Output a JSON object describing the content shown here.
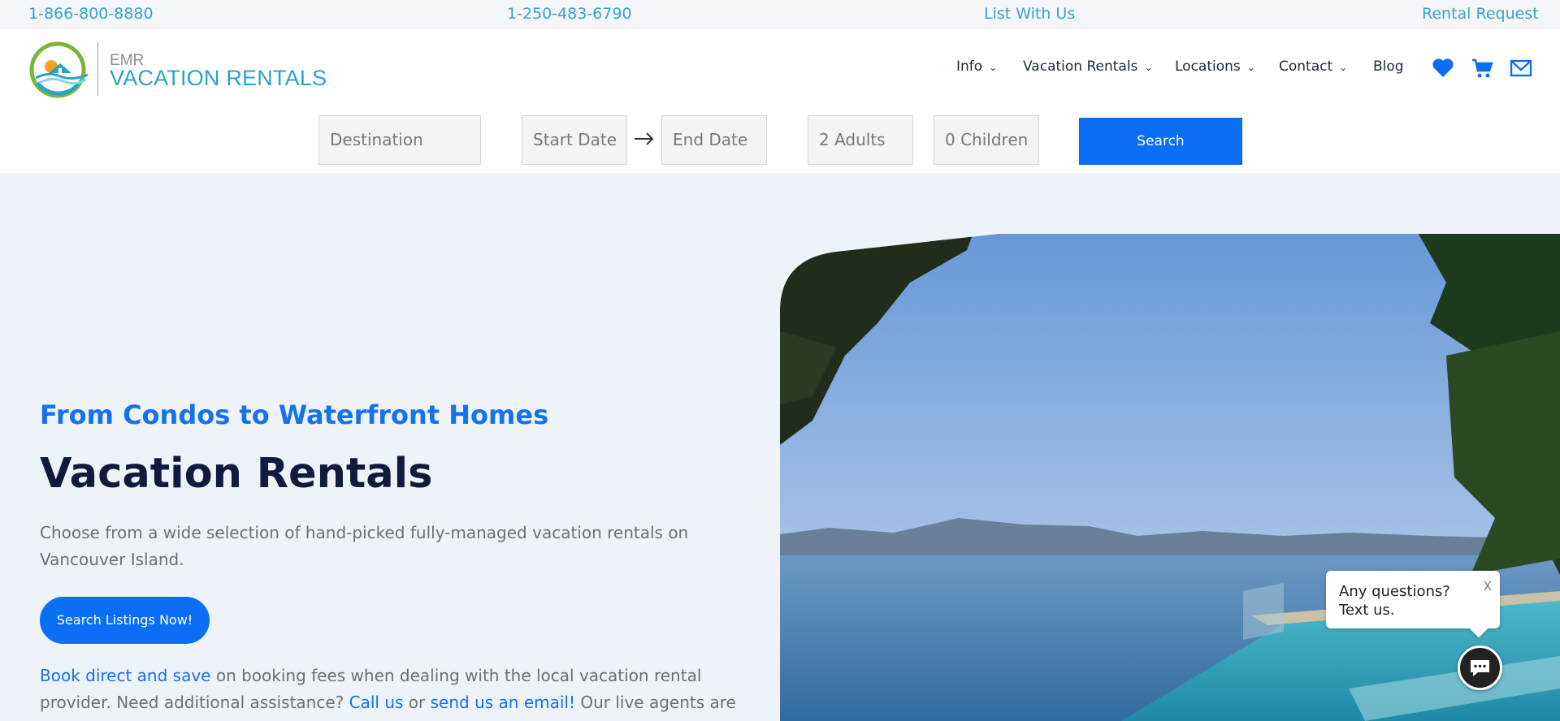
{
  "topbar": {
    "phone_tollfree": "1-866-800-8880",
    "phone_local": "1-250-483-6790",
    "list_with_us": "List With Us",
    "rental_request": "Rental Request"
  },
  "brand": {
    "small": "EMR",
    "big": "VACATION RENTALS",
    "colors": {
      "teal": "#2aa3c8",
      "green": "#7bb63a",
      "orange": "#f4a21e"
    }
  },
  "nav": {
    "items": [
      {
        "label": "Info",
        "has_dropdown": true
      },
      {
        "label": "Vacation Rentals",
        "has_dropdown": true
      },
      {
        "label": "Locations",
        "has_dropdown": true
      },
      {
        "label": "Contact",
        "has_dropdown": true
      },
      {
        "label": "Blog",
        "has_dropdown": false
      }
    ],
    "icons": [
      "heart-icon",
      "cart-icon",
      "mail-icon"
    ],
    "icon_color": "#0a6ff5"
  },
  "search": {
    "destination_placeholder": "Destination",
    "start_placeholder": "Start Date",
    "end_placeholder": "End Date",
    "adults": "2 Adults",
    "children": "0 Children",
    "button": "Search"
  },
  "hero": {
    "subtitle": "From Condos to Waterfront Homes",
    "title": "Vacation Rentals",
    "description": "Choose from a wide selection of hand-picked fully-managed vacation rentals on Vancouver Island.",
    "cta": "Search Listings Now!",
    "note_link1": "Book direct and save",
    "note_text1": " on booking fees when dealing with the local vacation rental provider. Need additional assistance? ",
    "note_link2": "Call us",
    "note_text2": " or ",
    "note_link3": "send us an email!",
    "note_text3": " Our live agents are here to help."
  },
  "chat": {
    "line1": "Any questions?",
    "line2": "Text us.",
    "close": "X"
  },
  "accent": "#0a6ff5"
}
